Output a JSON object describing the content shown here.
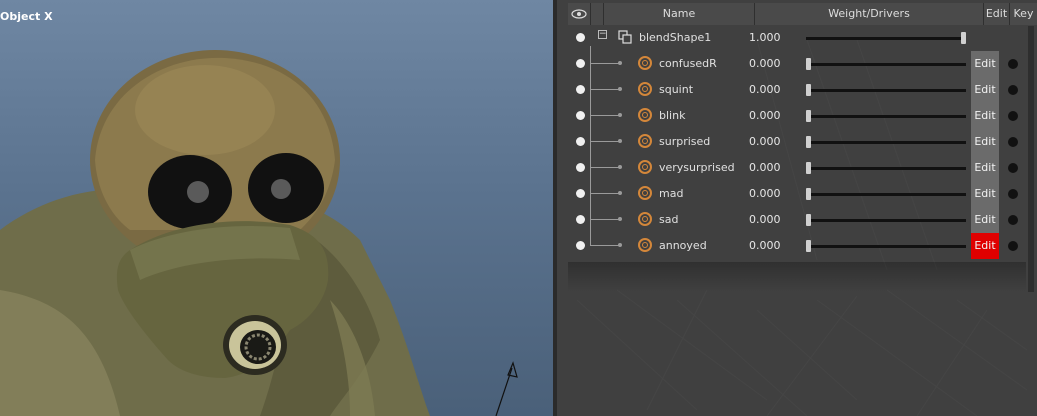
{
  "viewport": {
    "label": "Object X"
  },
  "panel": {
    "columns": {
      "visibility_icon": "eye-icon",
      "name": "Name",
      "weight": "Weight/Drivers",
      "edit": "Edit",
      "key": "Key"
    },
    "root": {
      "name": "blendShape1",
      "value": "1.000",
      "weight": 1.0
    },
    "targets": [
      {
        "name": "confusedR",
        "value": "0.000",
        "weight": 0.0,
        "edit": "Edit",
        "edit_active": false
      },
      {
        "name": "squint",
        "value": "0.000",
        "weight": 0.0,
        "edit": "Edit",
        "edit_active": false
      },
      {
        "name": "blink",
        "value": "0.000",
        "weight": 0.0,
        "edit": "Edit",
        "edit_active": false
      },
      {
        "name": "surprised",
        "value": "0.000",
        "weight": 0.0,
        "edit": "Edit",
        "edit_active": false
      },
      {
        "name": "verysurprised",
        "value": "0.000",
        "weight": 0.0,
        "edit": "Edit",
        "edit_active": false
      },
      {
        "name": "mad",
        "value": "0.000",
        "weight": 0.0,
        "edit": "Edit",
        "edit_active": false
      },
      {
        "name": "sad",
        "value": "0.000",
        "weight": 0.0,
        "edit": "Edit",
        "edit_active": false
      },
      {
        "name": "annoyed",
        "value": "0.000",
        "weight": 0.0,
        "edit": "Edit",
        "edit_active": true
      }
    ],
    "colors": {
      "edit_active": "#e00000",
      "edit_inactive": "#6b6b6b",
      "target_icon": "#d4873a"
    }
  }
}
